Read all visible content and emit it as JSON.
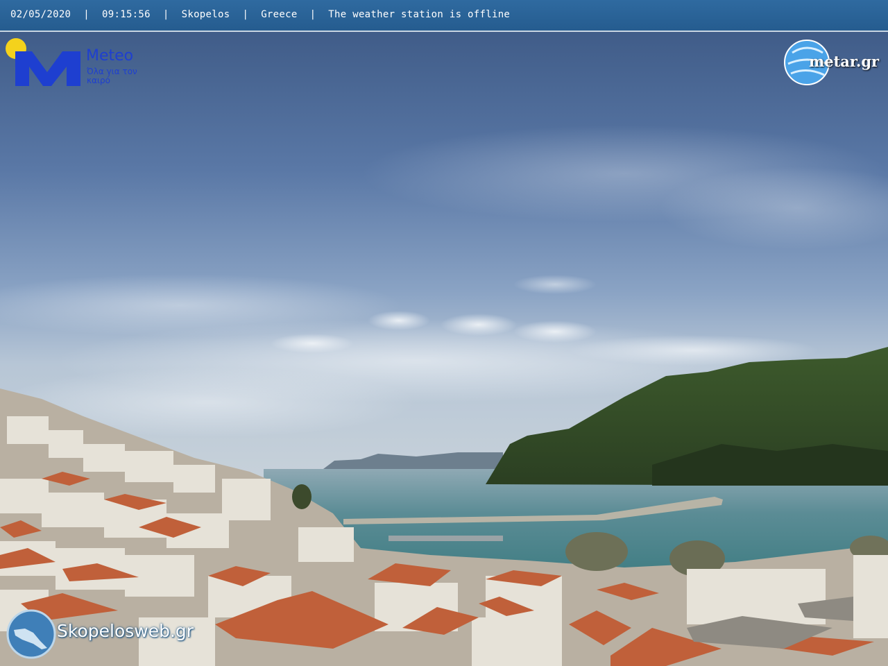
{
  "overlay": {
    "date": "02/05/2020",
    "time": "09:15:56",
    "location": "Skopelos",
    "country": "Greece",
    "status": "The weather station is offline",
    "separator": "|"
  },
  "logos": {
    "meteo_name": "Meteo",
    "meteo_tagline": "Όλα για τον καιρό",
    "metar": "metar.gr",
    "skopelosweb": "Skopelosweb.gr"
  },
  "colors": {
    "bar": "#2a639a",
    "sky_top": "#3f5b86",
    "sea": "#4e8a8c",
    "roof": "#c0603a",
    "meteo_blue": "#1e3fd0"
  }
}
